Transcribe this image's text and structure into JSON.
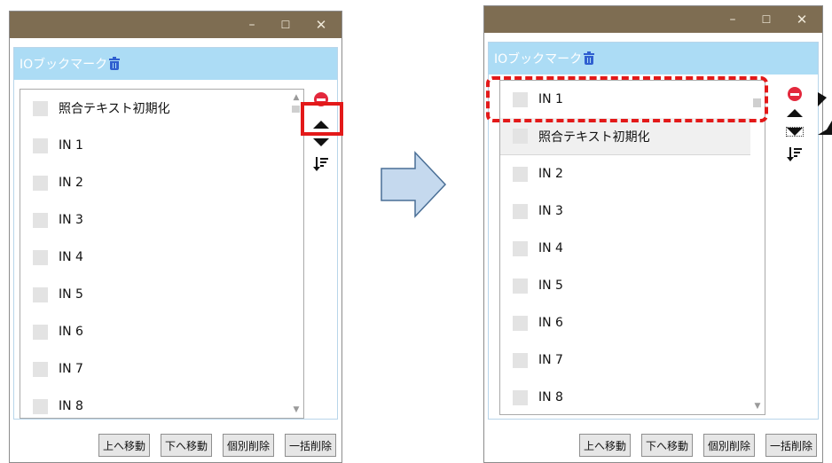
{
  "window_controls": {
    "minimize": "–",
    "maximize": "☐",
    "close": "✕"
  },
  "panel": {
    "title": "IOブックマーク",
    "icon": "trash-icon"
  },
  "left": {
    "items": [
      {
        "label": "照合テキスト初期化"
      },
      {
        "label": "IN 1"
      },
      {
        "label": "IN 2"
      },
      {
        "label": "IN 3"
      },
      {
        "label": "IN 4"
      },
      {
        "label": "IN 5"
      },
      {
        "label": "IN 6"
      },
      {
        "label": "IN 7"
      },
      {
        "label": "IN 8"
      }
    ]
  },
  "right": {
    "items": [
      {
        "label": "IN 1"
      },
      {
        "label": "照合テキスト初期化"
      },
      {
        "label": "IN 2"
      },
      {
        "label": "IN 3"
      },
      {
        "label": "IN 4"
      },
      {
        "label": "IN 5"
      },
      {
        "label": "IN 6"
      },
      {
        "label": "IN 7"
      },
      {
        "label": "IN 8"
      }
    ]
  },
  "buttons": {
    "move_up": "上へ移動",
    "move_down": "下へ移動",
    "delete_one": "個別削除",
    "delete_all": "一括削除"
  },
  "side_icons": [
    "remove-circle-icon",
    "move-up-icon",
    "move-down-icon",
    "sort-icon"
  ],
  "colors": {
    "titlebar": "#7e6d52",
    "header": "#acdcf5",
    "highlight": "#e31919",
    "arrow_fill": "#c5d9ee",
    "arrow_stroke": "#4a6f96"
  }
}
